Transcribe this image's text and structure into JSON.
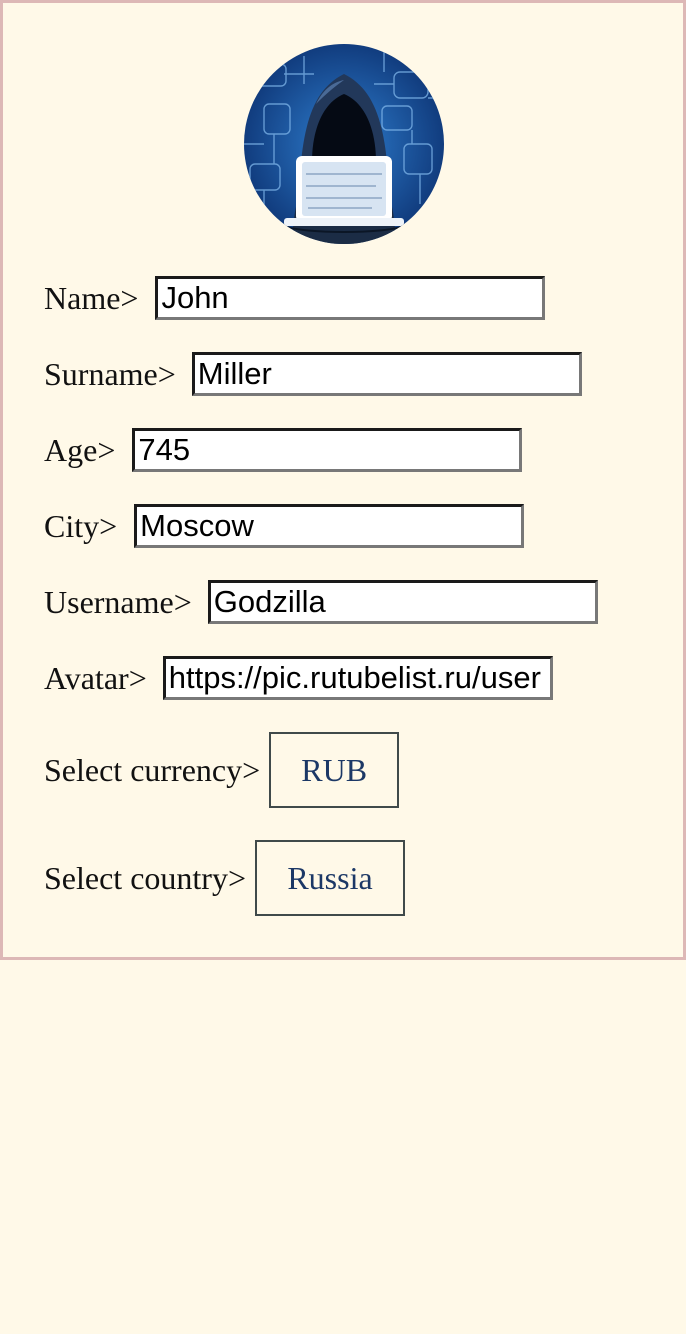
{
  "avatar": {
    "icon": "hooded-hacker-avatar"
  },
  "form": {
    "name": {
      "label": "Name>",
      "value": "John"
    },
    "surname": {
      "label": "Surname>",
      "value": "Miller"
    },
    "age": {
      "label": "Age>",
      "value": "745"
    },
    "city": {
      "label": "City>",
      "value": "Moscow"
    },
    "username": {
      "label": "Username>",
      "value": "Godzilla"
    },
    "avatar_url": {
      "label": "Avatar>",
      "value": "https://pic.rutubelist.ru/user"
    }
  },
  "currency": {
    "label": "Select currency>",
    "selected": "RUB"
  },
  "country": {
    "label": "Select country>",
    "selected": "Russia"
  },
  "colors": {
    "background": "#fff9e8",
    "card_border": "#ddb8b6",
    "select_text": "#1c3866"
  }
}
